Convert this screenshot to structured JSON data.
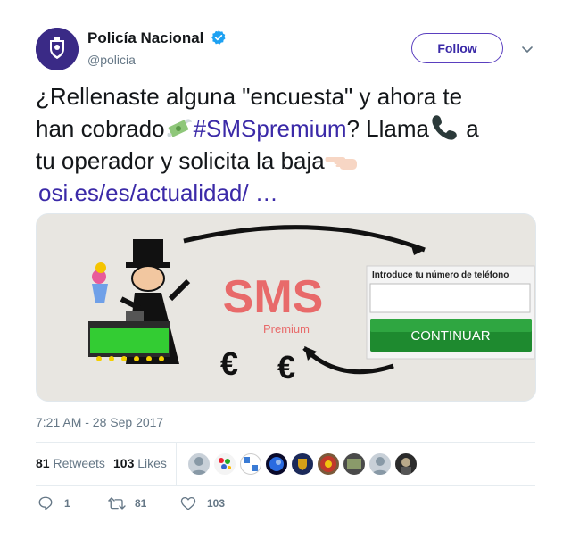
{
  "user": {
    "name": "Policía Nacional",
    "handle": "@policia",
    "verified_icon": "verified-badge-icon",
    "avatar_icon": "police-shield-logo"
  },
  "follow_label": "Follow",
  "tweet": {
    "line1": "¿Rellenaste alguna \"encuesta\" y ahora te",
    "line2_pre": "han cobrado",
    "hashtag": "#SMSpremium",
    "line2_post": "? Llama",
    "line2_end": " a",
    "line3": "tu operador y solicita la baja",
    "link": "osi.es/es/actualidad/   …"
  },
  "media": {
    "title": "SMS",
    "subtitle": "Premium",
    "form_label": "Introduce tu número de teléfono",
    "button_label": "CONTINUAR",
    "euro1": "€",
    "euro2": "€"
  },
  "timestamp": "7:21 AM - 28 Sep 2017",
  "stats": {
    "retweets_count": "81",
    "retweets_label": "Retweets",
    "likes_count": "103",
    "likes_label": "Likes"
  },
  "actions": {
    "reply_count": "1",
    "retweet_count": "81",
    "like_count": "103"
  },
  "colors": {
    "link": "#3b2aa8",
    "button_green": "#1e8a2f",
    "sms_red": "#e86a6a"
  }
}
